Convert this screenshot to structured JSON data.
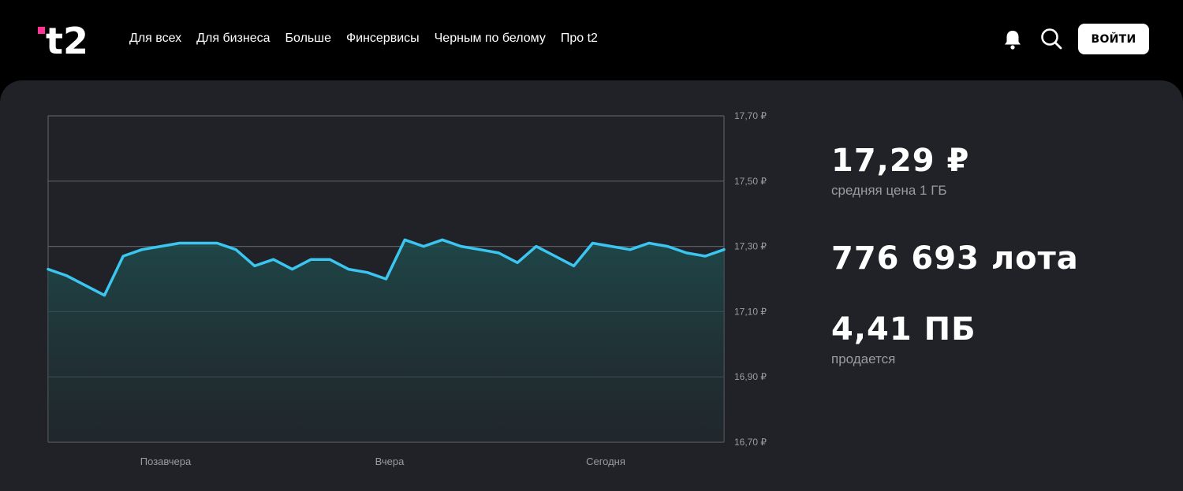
{
  "header": {
    "logo_text": "t2",
    "nav": [
      "Для всех",
      "Для бизнеса",
      "Больше",
      "Финсервисы",
      "Черным по белому",
      "Про t2"
    ],
    "login_label": "ВОЙТИ",
    "icons": [
      "bell-icon",
      "search-icon"
    ],
    "brand_accent": "#ff3495"
  },
  "stats": {
    "price": "17,29 ₽",
    "price_label": "средняя цена 1 ГБ",
    "lots": "776 693 лота",
    "volume": "4,41 ПБ",
    "volume_label": "продается"
  },
  "chart_data": {
    "type": "area",
    "y_tick_labels": [
      "17,70 ₽",
      "17,50 ₽",
      "17,30 ₽",
      "17,10 ₽",
      "16,90 ₽",
      "16,70 ₽"
    ],
    "x_labels": [
      "Позавчера",
      "Вчера",
      "Сегодня"
    ],
    "ylim": [
      16.7,
      17.7
    ],
    "grid": true,
    "line_color": "#3bc6f2",
    "series": [
      {
        "values": [
          17.23,
          17.21,
          17.18,
          17.15,
          17.27,
          17.29,
          17.3,
          17.31,
          17.31,
          17.31,
          17.29,
          17.24,
          17.26,
          17.23,
          17.26,
          17.26,
          17.23,
          17.22,
          17.2,
          17.32,
          17.3,
          17.32,
          17.3,
          17.29,
          17.28,
          17.25,
          17.3,
          17.27,
          17.24,
          17.31,
          17.3,
          17.29,
          17.31,
          17.3,
          17.28,
          17.27,
          17.29
        ]
      }
    ]
  }
}
